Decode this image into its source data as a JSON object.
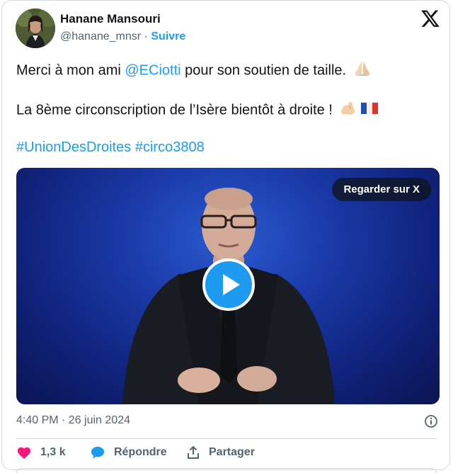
{
  "author": {
    "name": "Hanane Mansouri",
    "handle": "@hanane_mnsr",
    "separator": " · ",
    "follow_label": "Suivre"
  },
  "tweet": {
    "line1_prefix": "Merci à mon ami ",
    "line1_mention": "@ECiotti",
    "line1_suffix": " pour son soutien de taille. ",
    "line1_emoji": "🙏🏻",
    "line2_text": "La 8ème circonscription de l’Isère bientôt à droite ! ",
    "line2_emoji": "💪🏻🇫🇷",
    "hashtag1": "#UnionDesDroites",
    "hashtag2": "#circo3808"
  },
  "media": {
    "watch_label": "Regarder sur X"
  },
  "timestamp": "4:40 PM · 26 juin 2024",
  "actions": {
    "like_count": "1,3 k",
    "reply_label": "Répondre",
    "share_label": "Partager"
  },
  "colors": {
    "accent": "#1d9bf0",
    "like": "#f91880",
    "muted": "#536471",
    "text": "#0f1419"
  },
  "icons": [
    "x-logo-icon",
    "play-icon",
    "info-icon",
    "heart-icon",
    "reply-icon",
    "share-icon"
  ]
}
